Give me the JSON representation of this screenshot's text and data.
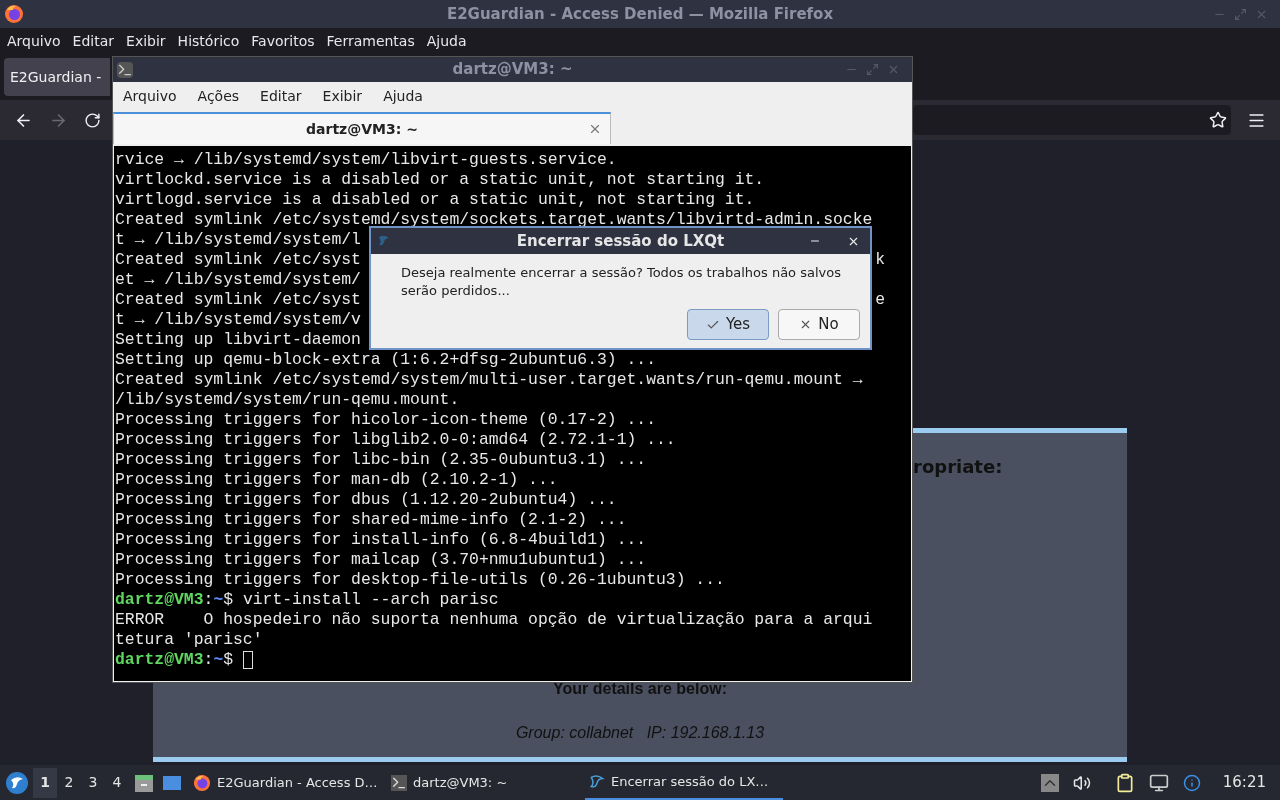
{
  "firefox": {
    "title": "E2Guardian - Access Denied — Mozilla Firefox",
    "menu": [
      "Arquivo",
      "Editar",
      "Exibir",
      "Histórico",
      "Favoritos",
      "Ferramentas",
      "Ajuda"
    ],
    "tab": {
      "label": "E2Guardian -",
      "selected": true
    },
    "nav": {
      "forward_disabled": true
    },
    "page": {
      "heading": "ropriate:",
      "details_title": "Your details are below:",
      "details": "Group: collabnet   IP: 192.168.1.13"
    }
  },
  "terminal": {
    "title": "dartz@VM3: ~",
    "menu": [
      "Arquivo",
      "Ações",
      "Editar",
      "Exibir",
      "Ajuda"
    ],
    "tab": {
      "label": "dartz@VM3: ~",
      "selected": true
    },
    "lines": [
      {
        "kind": "output",
        "text": "rvice → /lib/systemd/system/libvirt-guests.service."
      },
      {
        "kind": "output",
        "text": "virtlockd.service is a disabled or a static unit, not starting it."
      },
      {
        "kind": "output",
        "text": "virtlogd.service is a disabled or a static unit, not starting it."
      },
      {
        "kind": "output",
        "text": "Created symlink /etc/systemd/system/sockets.target.wants/libvirtd-admin.socke"
      },
      {
        "kind": "output",
        "text": "t → /lib/systemd/system/l"
      },
      {
        "kind": "output",
        "text": "Created symlink /etc/syst",
        "tail": "k"
      },
      {
        "kind": "output",
        "text": "et → /lib/systemd/system/"
      },
      {
        "kind": "output",
        "text": "Created symlink /etc/syst",
        "tail": "e"
      },
      {
        "kind": "output",
        "text": "t → /lib/systemd/system/v"
      },
      {
        "kind": "output",
        "text": "Setting up libvirt-daemon"
      },
      {
        "kind": "output",
        "text": "Setting up qemu-block-extra (1:6.2+dfsg-2ubuntu6.3) ..."
      },
      {
        "kind": "output",
        "text": "Created symlink /etc/systemd/system/multi-user.target.wants/run-qemu.mount →"
      },
      {
        "kind": "output",
        "text": "/lib/systemd/system/run-qemu.mount."
      },
      {
        "kind": "output",
        "text": "Processing triggers for hicolor-icon-theme (0.17-2) ..."
      },
      {
        "kind": "output",
        "text": "Processing triggers for libglib2.0-0:amd64 (2.72.1-1) ..."
      },
      {
        "kind": "output",
        "text": "Processing triggers for libc-bin (2.35-0ubuntu3.1) ..."
      },
      {
        "kind": "output",
        "text": "Processing triggers for man-db (2.10.2-1) ..."
      },
      {
        "kind": "output",
        "text": "Processing triggers for dbus (1.12.20-2ubuntu4) ..."
      },
      {
        "kind": "output",
        "text": "Processing triggers for shared-mime-info (2.1-2) ..."
      },
      {
        "kind": "output",
        "text": "Processing triggers for install-info (6.8-4build1) ..."
      },
      {
        "kind": "output",
        "text": "Processing triggers for mailcap (3.70+nmu1ubuntu1) ..."
      },
      {
        "kind": "output",
        "text": "Processing triggers for desktop-file-utils (0.26-1ubuntu3) ..."
      },
      {
        "kind": "prompt",
        "user": "dartz@VM3",
        "sep": ":",
        "path": "~",
        "symbol": "$",
        "command": "virt-install --arch parisc",
        "cursor": false
      },
      {
        "kind": "output",
        "text": "ERROR    O hospedeiro não suporta nenhuma opção de virtualização para a arqui"
      },
      {
        "kind": "output",
        "text": "tetura 'parisc'"
      },
      {
        "kind": "prompt",
        "user": "dartz@VM3",
        "sep": ":",
        "path": "~",
        "symbol": "$",
        "cursor": true
      }
    ]
  },
  "dialog": {
    "title": "Encerrar sessão do LXQt",
    "message": "Deseja realmente encerrar a sessão? Todos os trabalhos não salvos serão perdidos...",
    "buttons": [
      {
        "kind": "yes",
        "label": "Yes",
        "selected": true
      },
      {
        "kind": "no",
        "label": "No",
        "selected": false
      }
    ]
  },
  "taskbar": {
    "desktops": [
      {
        "label": "1",
        "selected": true
      },
      {
        "label": "2",
        "selected": false
      },
      {
        "label": "3",
        "selected": false
      },
      {
        "label": "4",
        "selected": false
      }
    ],
    "tasks": [
      {
        "kind": "firefox",
        "label": "E2Guardian - Access D…",
        "selected": false
      },
      {
        "kind": "terminal",
        "label": "dartz@VM3: ~",
        "selected": false
      },
      {
        "kind": "dialog",
        "label": "Encerrar sessão do LX…",
        "selected": true
      }
    ],
    "clock": "16:21"
  }
}
